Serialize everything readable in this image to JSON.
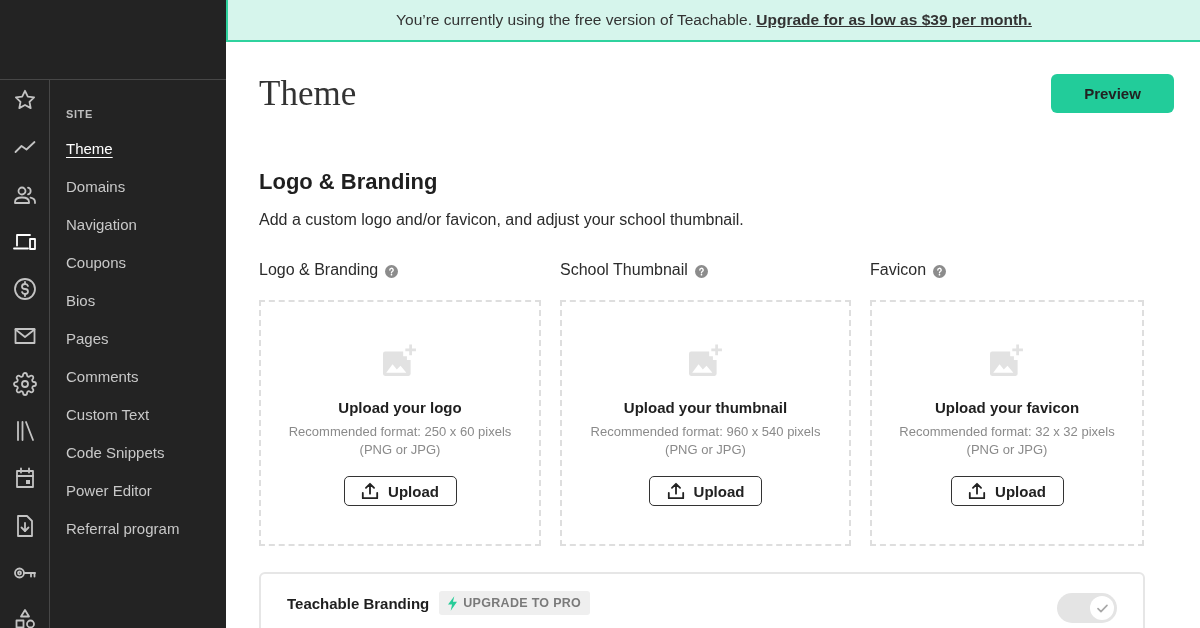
{
  "sidebar": {
    "rail_items": [
      {
        "selected": false
      },
      {
        "selected": false
      },
      {
        "selected": false
      },
      {
        "selected": true
      },
      {
        "selected": false
      },
      {
        "selected": false
      },
      {
        "selected": false
      },
      {
        "selected": false
      },
      {
        "selected": false
      },
      {
        "selected": false
      },
      {
        "selected": false
      },
      {
        "selected": false
      }
    ],
    "section_heading": "SITE",
    "nav_items": [
      {
        "label": "Theme",
        "selected": true
      },
      {
        "label": "Domains",
        "selected": false
      },
      {
        "label": "Navigation",
        "selected": false
      },
      {
        "label": "Coupons",
        "selected": false
      },
      {
        "label": "Bios",
        "selected": false
      },
      {
        "label": "Pages",
        "selected": false
      },
      {
        "label": "Comments",
        "selected": false
      },
      {
        "label": "Custom Text",
        "selected": false
      },
      {
        "label": "Code Snippets",
        "selected": false
      },
      {
        "label": "Power Editor",
        "selected": false
      },
      {
        "label": "Referral program",
        "selected": false
      }
    ]
  },
  "banner": {
    "message": "You’re currently using the free version of Teachable.",
    "link": "Upgrade for as low as $39 per month."
  },
  "header": {
    "title": "Theme",
    "preview_button": "Preview"
  },
  "logo_branding": {
    "title": "Logo & Branding",
    "description": "Add a custom logo and/or favicon, and adjust your school thumbnail.",
    "uploads": [
      {
        "label": "Logo & Branding",
        "title": "Upload your logo",
        "format": "Recommended format: 250 x 60 pixels",
        "types": "(PNG or JPG)",
        "button": "Upload"
      },
      {
        "label": "School Thumbnail",
        "title": "Upload your thumbnail",
        "format": "Recommended format: 960 x 540 pixels",
        "types": "(PNG or JPG)",
        "button": "Upload"
      },
      {
        "label": "Favicon",
        "title": "Upload your favicon",
        "format": "Recommended format: 32 x 32 pixels",
        "types": "(PNG or JPG)",
        "button": "Upload"
      }
    ]
  },
  "teachable_branding": {
    "label": "Teachable Branding",
    "badge": "UPGRADE TO PRO",
    "toggle": {
      "on": true,
      "disabled": true
    }
  }
}
